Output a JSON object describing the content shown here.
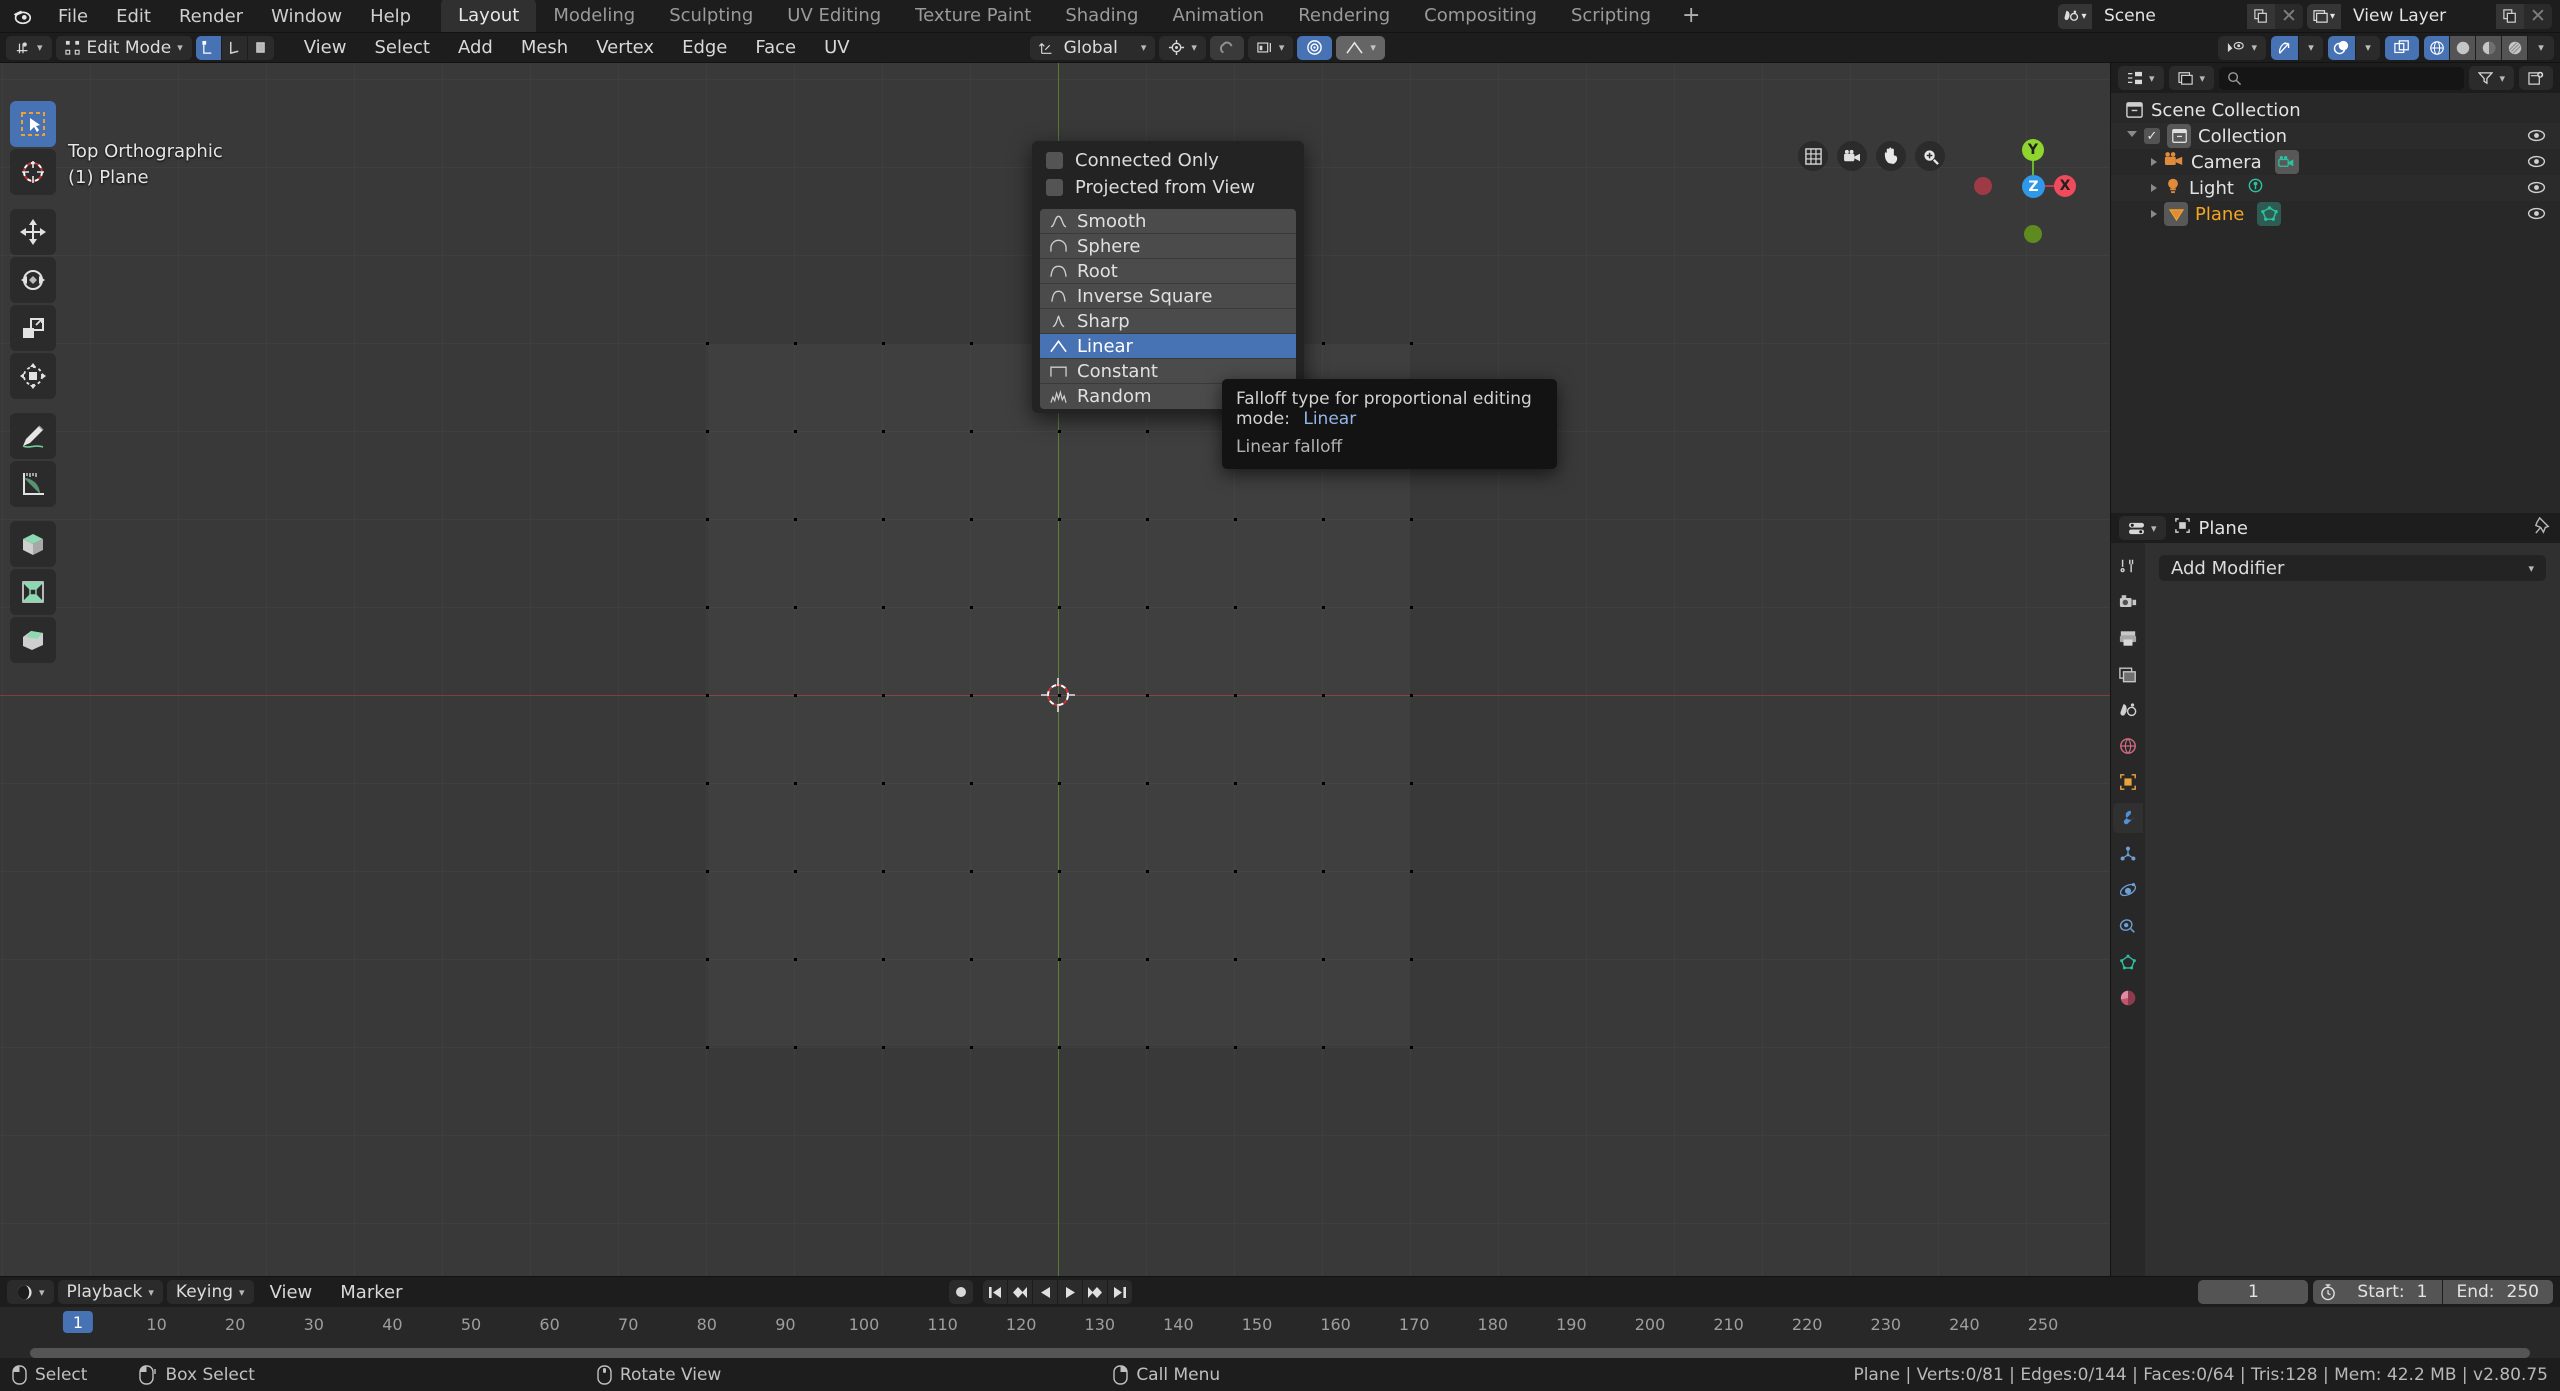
{
  "topbar": {
    "logo_icon": "blender-logo-icon",
    "menus": [
      "File",
      "Edit",
      "Render",
      "Window",
      "Help"
    ],
    "workspaces": [
      {
        "label": "Layout",
        "active": true
      },
      {
        "label": "Modeling",
        "active": false
      },
      {
        "label": "Sculpting",
        "active": false
      },
      {
        "label": "UV Editing",
        "active": false
      },
      {
        "label": "Texture Paint",
        "active": false
      },
      {
        "label": "Shading",
        "active": false
      },
      {
        "label": "Animation",
        "active": false
      },
      {
        "label": "Rendering",
        "active": false
      },
      {
        "label": "Compositing",
        "active": false
      },
      {
        "label": "Scripting",
        "active": false
      }
    ],
    "add_workspace_label": "+",
    "scene_name": "Scene",
    "view_layer_name": "View Layer"
  },
  "viewport_header": {
    "editor_type_icon": "editor-type-icon",
    "mode": "Edit Mode",
    "select_modes": [
      "vertex-select-icon",
      "edge-select-icon",
      "face-select-icon"
    ],
    "menus": [
      "View",
      "Select",
      "Add",
      "Mesh",
      "Vertex",
      "Edge",
      "Face",
      "UV"
    ],
    "transform_orientation": "Global",
    "snap_icon": "magnet-icon",
    "proportional_edit_icon": "proportional-edit-icon",
    "falloff_icon": "falloff-linear-icon",
    "visibility_icon": "show-hide-icon",
    "gizmo_icon": "gizmo-icon",
    "overlays_icon": "overlays-icon",
    "xray_icon": "xray-icon",
    "shading_modes": [
      "wireframe-shading-icon",
      "solid-shading-icon",
      "material-preview-icon",
      "rendered-shading-icon"
    ]
  },
  "viewport": {
    "view_label": "Top Orthographic",
    "object_label": "(1) Plane",
    "tools": [
      "tweak-select-box-tool",
      "cursor-tool",
      "move-tool",
      "rotate-tool",
      "scale-tool",
      "transform-tool",
      "annotate-tool",
      "measure-tool",
      "add-cube-tool",
      "extrude-region-tool",
      "inset-faces-tool"
    ],
    "nav_buttons": [
      "toggle-grid-icon",
      "camera-view-icon",
      "pan-view-icon",
      "zoom-view-icon"
    ],
    "gizmo_axes": [
      "X",
      "Y",
      "Z"
    ]
  },
  "popover": {
    "checkboxes": [
      {
        "label": "Connected Only",
        "checked": false
      },
      {
        "label": "Projected from View",
        "checked": false
      }
    ],
    "falloff_items": [
      {
        "label": "Smooth",
        "icon": "falloff-smooth-icon",
        "selected": false
      },
      {
        "label": "Sphere",
        "icon": "falloff-sphere-icon",
        "selected": false
      },
      {
        "label": "Root",
        "icon": "falloff-root-icon",
        "selected": false
      },
      {
        "label": "Inverse Square",
        "icon": "falloff-inverse-square-icon",
        "selected": false
      },
      {
        "label": "Sharp",
        "icon": "falloff-sharp-icon",
        "selected": false
      },
      {
        "label": "Linear",
        "icon": "falloff-linear-icon",
        "selected": true
      },
      {
        "label": "Constant",
        "icon": "falloff-constant-icon",
        "selected": false
      },
      {
        "label": "Random",
        "icon": "falloff-random-icon",
        "selected": false
      }
    ]
  },
  "tooltip": {
    "title": "Falloff type for proportional editing mode:",
    "value": "Linear",
    "description": "Linear falloff"
  },
  "outliner": {
    "display_mode_icon": "outliner-display-mode-icon",
    "filter_id_icon": "outliner-id-type-icon",
    "search_placeholder": "",
    "filter_icon": "filter-icon",
    "new_collection_icon": "new-collection-icon",
    "rows": [
      {
        "label": "Scene Collection",
        "icon": "scene-collection-icon",
        "indent": 0,
        "expand": "none",
        "checkbox": false,
        "eye": false,
        "color": "#d6d6d6",
        "badge": null
      },
      {
        "label": "Collection",
        "icon": "collection-icon",
        "indent": 1,
        "expand": "down",
        "checkbox": true,
        "eye": true,
        "color": "#d6d6d6",
        "badge": null
      },
      {
        "label": "Camera",
        "icon": "camera-object-icon",
        "indent": 2,
        "expand": "right",
        "checkbox": false,
        "eye": true,
        "color": "#d6d6d6",
        "badge": "camera-data-icon"
      },
      {
        "label": "Light",
        "icon": "light-object-icon",
        "indent": 2,
        "expand": "right",
        "checkbox": false,
        "eye": true,
        "color": "#d6d6d6",
        "badge": "light-data-icon"
      },
      {
        "label": "Plane",
        "icon": "mesh-object-icon",
        "indent": 2,
        "expand": "right",
        "checkbox": false,
        "eye": true,
        "color": "#f5a623",
        "badge": "mesh-data-icon"
      }
    ]
  },
  "properties": {
    "editor_icon": "properties-editor-icon",
    "breadcrumb_icon": "object-icon",
    "breadcrumb": "Plane",
    "pin_icon": "pin-icon",
    "tabs": [
      {
        "name": "tool-tab",
        "active": false
      },
      {
        "name": "render-tab",
        "active": false
      },
      {
        "name": "output-tab",
        "active": false
      },
      {
        "name": "view-layer-tab",
        "active": false
      },
      {
        "name": "scene-tab",
        "active": false
      },
      {
        "name": "world-tab",
        "active": false
      },
      {
        "name": "object-tab",
        "active": false
      },
      {
        "name": "modifier-tab",
        "active": true
      },
      {
        "name": "particles-tab",
        "active": false
      },
      {
        "name": "physics-tab",
        "active": false
      },
      {
        "name": "constraints-tab",
        "active": false
      },
      {
        "name": "data-tab",
        "active": false
      },
      {
        "name": "material-tab",
        "active": false
      }
    ],
    "add_modifier_label": "Add Modifier"
  },
  "timeline": {
    "editor_icon": "timeline-editor-icon",
    "menus": [
      "Playback",
      "Keying",
      "View",
      "Marker"
    ],
    "playback_buttons": [
      "record-icon",
      "jump-to-start-icon",
      "prev-keyframe-icon",
      "play-reverse-icon",
      "play-icon",
      "next-keyframe-icon",
      "jump-to-end-icon"
    ],
    "current_frame": "1",
    "autokey_icon": "auto-keying-icon",
    "start_label": "Start:",
    "start_value": "1",
    "end_label": "End:",
    "end_value": "250",
    "ticks": [
      "1",
      "10",
      "20",
      "30",
      "40",
      "50",
      "60",
      "70",
      "80",
      "90",
      "100",
      "110",
      "120",
      "130",
      "140",
      "150",
      "160",
      "170",
      "180",
      "190",
      "200",
      "210",
      "220",
      "230",
      "240",
      "250"
    ],
    "playhead_label": "1"
  },
  "statusbar": {
    "items": [
      {
        "icon": "mouse-left-icon",
        "label": "Select"
      },
      {
        "icon": "mouse-drag-icon",
        "label": "Box Select"
      },
      {
        "icon": "mouse-middle-icon",
        "label": "Rotate View"
      },
      {
        "icon": "mouse-right-icon",
        "label": "Call Menu"
      }
    ],
    "stats": "Plane | Verts:0/81 | Edges:0/144 | Faces:0/64 | Tris:128 | Mem: 42.2 MB | v2.80.75"
  },
  "colors": {
    "accent": "#4772b3",
    "selected_object": "#f5a623",
    "viewport_bg": "#393939",
    "panel_bg": "#303030",
    "header_bg": "#1d1d1d"
  }
}
